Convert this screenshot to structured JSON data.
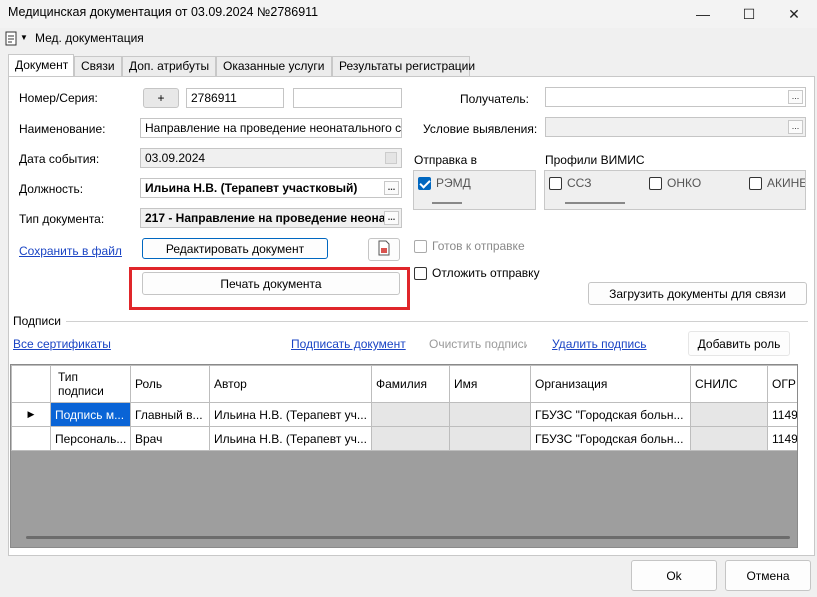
{
  "window": {
    "title": "Медицинская документация от 03.09.2024 №2786911",
    "minimize": "—",
    "maximize": "☐",
    "close": "✕"
  },
  "menu": {
    "label": "Мед. документация"
  },
  "tabs": [
    "Документ",
    "Связи",
    "Доп. атрибуты",
    "Оказанные услуги",
    "Результаты регистрации"
  ],
  "form": {
    "number_label": "Номер/Серия:",
    "plus_label": "+",
    "number_value": "2786911",
    "series_value": "",
    "name_label": "Наименование:",
    "name_value": "Направление на проведение неонатального с",
    "date_label": "Дата события:",
    "date_value": "03.09.2024",
    "position_label": "Должность:",
    "position_value": "Ильина Н.В. (Терапевт участковый)",
    "doctype_label": "Тип документа:",
    "doctype_value": "217 - Направление на проведение неона",
    "recipient_label": "Получатель:",
    "recipient_value": "",
    "condition_label": "Условие выявления:",
    "condition_value": "",
    "ellipsis": "..."
  },
  "links": {
    "save_to_file": "Сохранить в файл",
    "all_certs": "Все сертификаты",
    "sign_doc": "Подписать документ",
    "clear_signatures": "Очистить подписи",
    "delete_signature": "Удалить подпись"
  },
  "buttons": {
    "edit_doc": "Редактировать документ",
    "print_doc": "Печать документа",
    "load_docs": "Загрузить документы для связи",
    "add_role": "Добавить роль",
    "ok": "Ok",
    "cancel": "Отмена"
  },
  "sending": {
    "label": "Отправка в",
    "remd": "РЭМД",
    "remd_checked": true
  },
  "vimis": {
    "label": "Профили ВИМИС",
    "items": [
      "ССЗ",
      "ОНКО",
      "АКИНЕ"
    ]
  },
  "checks": {
    "ready": "Готов к отправке",
    "postpone": "Отложить отправку"
  },
  "signatures": {
    "label": "Подписи",
    "columns": [
      "Тип подписи",
      "Роль",
      "Автор",
      "Фамилия",
      "Имя",
      "Организация",
      "СНИЛС",
      "ОГР"
    ],
    "rows": [
      [
        "Подпись м...",
        "Главный в...",
        "Ильина Н.В. (Терапевт уч...",
        "",
        "",
        "ГБУЗС \"Городская больн...",
        "",
        "1149"
      ],
      [
        "Персональ...",
        "Врач",
        "Ильина Н.В. (Терапевт уч...",
        "",
        "",
        "ГБУЗС \"Городская больн...",
        "",
        "1149"
      ]
    ]
  },
  "colors": {
    "link": "#1a44c4",
    "selected": "#0a64d6",
    "highlight": "#e0262a"
  },
  "icons": [
    "document-menu-icon",
    "chevron-down-icon",
    "document-sign-icon",
    "row-pointer-icon"
  ]
}
